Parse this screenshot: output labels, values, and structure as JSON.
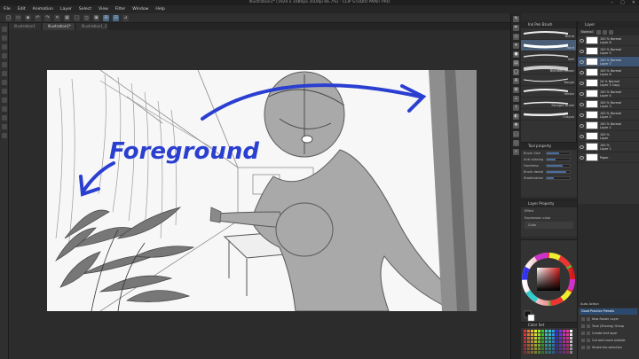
{
  "window": {
    "title": "Illustration1* (1920 x 1080px 350dpi 66.7%) - CLIP STUDIO PAINT PRO",
    "minimize": "–",
    "maximize": "▢",
    "close": "✕"
  },
  "menu": [
    "File",
    "Edit",
    "Animation",
    "Layer",
    "Select",
    "View",
    "Filter",
    "Window",
    "Help"
  ],
  "tabs": [
    "Illustration1",
    "Illustration1*",
    "Illustration1_2"
  ],
  "artwork": {
    "annotation": "Foreground",
    "ink_color": "#2a3fd0"
  },
  "brush_panel": {
    "header": "Ink Pen Brush",
    "brushes": [
      "Blend",
      "Hard",
      "Soft",
      "Blended smear",
      "Rough",
      "Vector",
      "Straight brush",
      "Crayon"
    ]
  },
  "tool_property": {
    "header": "Tool property",
    "rows": [
      {
        "label": "Brush Size",
        "fill": 0.55
      },
      {
        "label": "Anti-aliasing",
        "fill": 0.4
      },
      {
        "label": "Hardness",
        "fill": 0.7
      },
      {
        "label": "Brush density",
        "fill": 0.85
      },
      {
        "label": "Stabilization",
        "fill": 0.3
      }
    ]
  },
  "layer_property": {
    "header": "Layer Property",
    "effect": "Effect",
    "expression": "Expression color",
    "color": "Color"
  },
  "layer_panel": {
    "header": "Layer",
    "blend_mode": "Normal",
    "layers": [
      {
        "name": "100 % Normal",
        "sub": "Layer 8",
        "selected": false
      },
      {
        "name": "100 % Normal",
        "sub": "Layer 5",
        "selected": false
      },
      {
        "name": "100 % Normal",
        "sub": "Layer 7",
        "selected": true
      },
      {
        "name": "100 % Normal",
        "sub": "Layer 6",
        "selected": false
      },
      {
        "name": "24 % Normal",
        "sub": "Layer 5 Copy",
        "selected": false
      },
      {
        "name": "100 % Normal",
        "sub": "Layer 4",
        "selected": false
      },
      {
        "name": "100 % Normal",
        "sub": "Layer 3",
        "selected": false
      },
      {
        "name": "100 % Normal",
        "sub": "Layer 2",
        "selected": false
      },
      {
        "name": "100 % Normal",
        "sub": "Layer 1",
        "selected": false
      },
      {
        "name": "100 %",
        "sub": "Layer",
        "selected": false
      },
      {
        "name": "100 %",
        "sub": "Layer 1",
        "selected": false
      },
      {
        "name": "Paper",
        "sub": "",
        "selected": false
      }
    ]
  },
  "auto_action": {
    "header": "Auto Action",
    "set": "Good Practice Presets",
    "items": [
      "New Raster Layer",
      "Tone (Sharing) Group",
      "Create text layer",
      "Cut and move outside",
      "Stroke the selection"
    ]
  },
  "color_set": {
    "header": "Color Set"
  }
}
